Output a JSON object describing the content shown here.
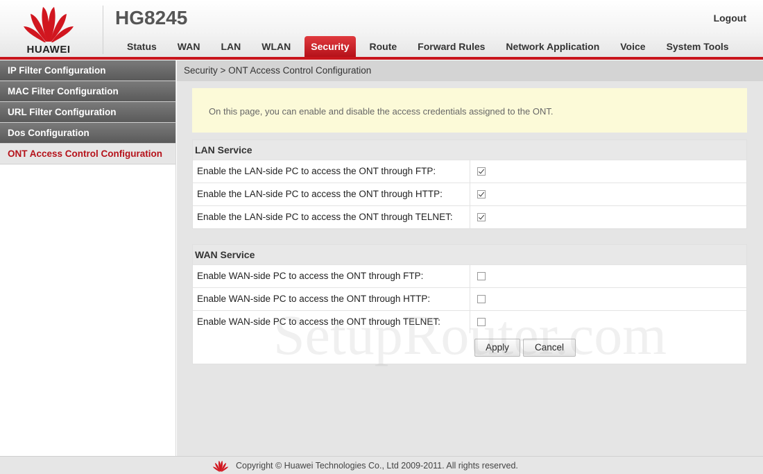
{
  "header": {
    "brand": "HUAWEI",
    "model": "HG8245",
    "logout_label": "Logout"
  },
  "nav": {
    "items": [
      "Status",
      "WAN",
      "LAN",
      "WLAN",
      "Security",
      "Route",
      "Forward Rules",
      "Network Application",
      "Voice",
      "System Tools"
    ],
    "active": "Security"
  },
  "sidebar": {
    "items": [
      "IP Filter Configuration",
      "MAC Filter Configuration",
      "URL Filter Configuration",
      "Dos Configuration",
      "ONT Access Control Configuration"
    ],
    "active": "ONT Access Control Configuration"
  },
  "breadcrumb": "Security > ONT Access Control Configuration",
  "notice": "On this page, you can enable and disable the access credentials assigned to the ONT.",
  "lan_service": {
    "title": "LAN Service",
    "rows": [
      {
        "label": "Enable the LAN-side PC to access the ONT through FTP:",
        "checked": true
      },
      {
        "label": "Enable the LAN-side PC to access the ONT through HTTP:",
        "checked": true
      },
      {
        "label": "Enable the LAN-side PC to access the ONT through TELNET:",
        "checked": true
      }
    ]
  },
  "wan_service": {
    "title": "WAN Service",
    "rows": [
      {
        "label": "Enable WAN-side PC to access the ONT through FTP:",
        "checked": false
      },
      {
        "label": "Enable WAN-side PC to access the ONT through HTTP:",
        "checked": false
      },
      {
        "label": "Enable WAN-side PC to access the ONT through TELNET:",
        "checked": false
      }
    ]
  },
  "buttons": {
    "apply": "Apply",
    "cancel": "Cancel"
  },
  "footer": {
    "copyright": "Copyright © Huawei Technologies Co., Ltd 2009-2011. All rights reserved."
  },
  "watermark": "SetupRouter.com",
  "colors": {
    "accent": "#c8161d",
    "sidebar_bg": "#666666",
    "notice_bg": "#fcfad8"
  }
}
